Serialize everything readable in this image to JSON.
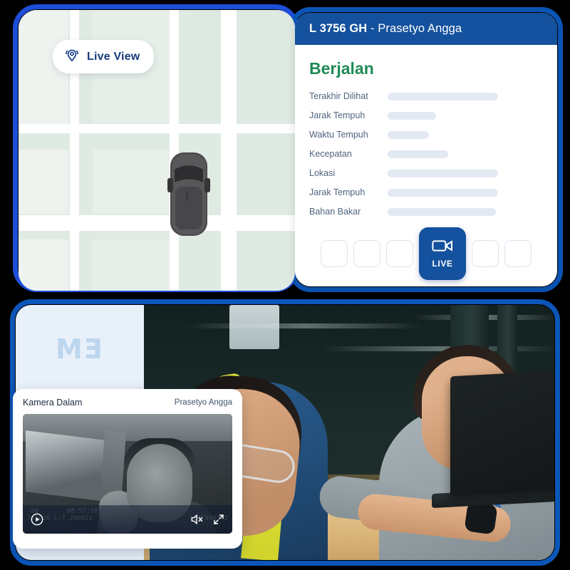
{
  "map": {
    "live_view_button": {
      "label": "Live View",
      "icon": "location-broadcast-icon"
    },
    "vehicle_marker": {
      "icon": "vehicle-top-view-icon"
    }
  },
  "detail_panel": {
    "header": {
      "plate": "L 3756 GH",
      "separator": " - ",
      "driver": "Prasetyo Angga"
    },
    "status": "Berjalan",
    "status_color": "#1f8a55",
    "header_color": "#14519e",
    "rows": [
      {
        "label": "Terakhir Dilihat",
        "value_width": 155
      },
      {
        "label": "Jarak Tempuh",
        "value_width": 68
      },
      {
        "label": "Waktu Tempuh",
        "value_width": 58
      },
      {
        "label": "Kecepatan",
        "value_width": 85
      },
      {
        "label": "Lokasi",
        "value_width": 155
      },
      {
        "label": "Jarak Tempuh",
        "value_width": 155
      },
      {
        "label": "Bahan Bakar",
        "value_width": 152
      }
    ],
    "actions": [
      {
        "name": "action-1",
        "label": ""
      },
      {
        "name": "action-2",
        "label": ""
      },
      {
        "name": "action-3",
        "label": ""
      },
      {
        "name": "action-live",
        "label": "LIVE",
        "icon": "video-camera-icon",
        "active": true
      },
      {
        "name": "action-4",
        "label": ""
      },
      {
        "name": "action-5",
        "label": ""
      }
    ]
  },
  "brand": {
    "logo_text_1": "M",
    "logo_text_2": "E"
  },
  "video_card": {
    "title": "Kamera Dalam",
    "driver": "Prasetyo Angga",
    "osd": {
      "date": "-06",
      "time": "08:57:38",
      "coords": "745038   L:7.266021",
      "device_id": "8697980502"
    },
    "controls": {
      "play": "play-icon",
      "mute": "speaker-muted-icon",
      "fullscreen": "fullscreen-icon"
    }
  }
}
